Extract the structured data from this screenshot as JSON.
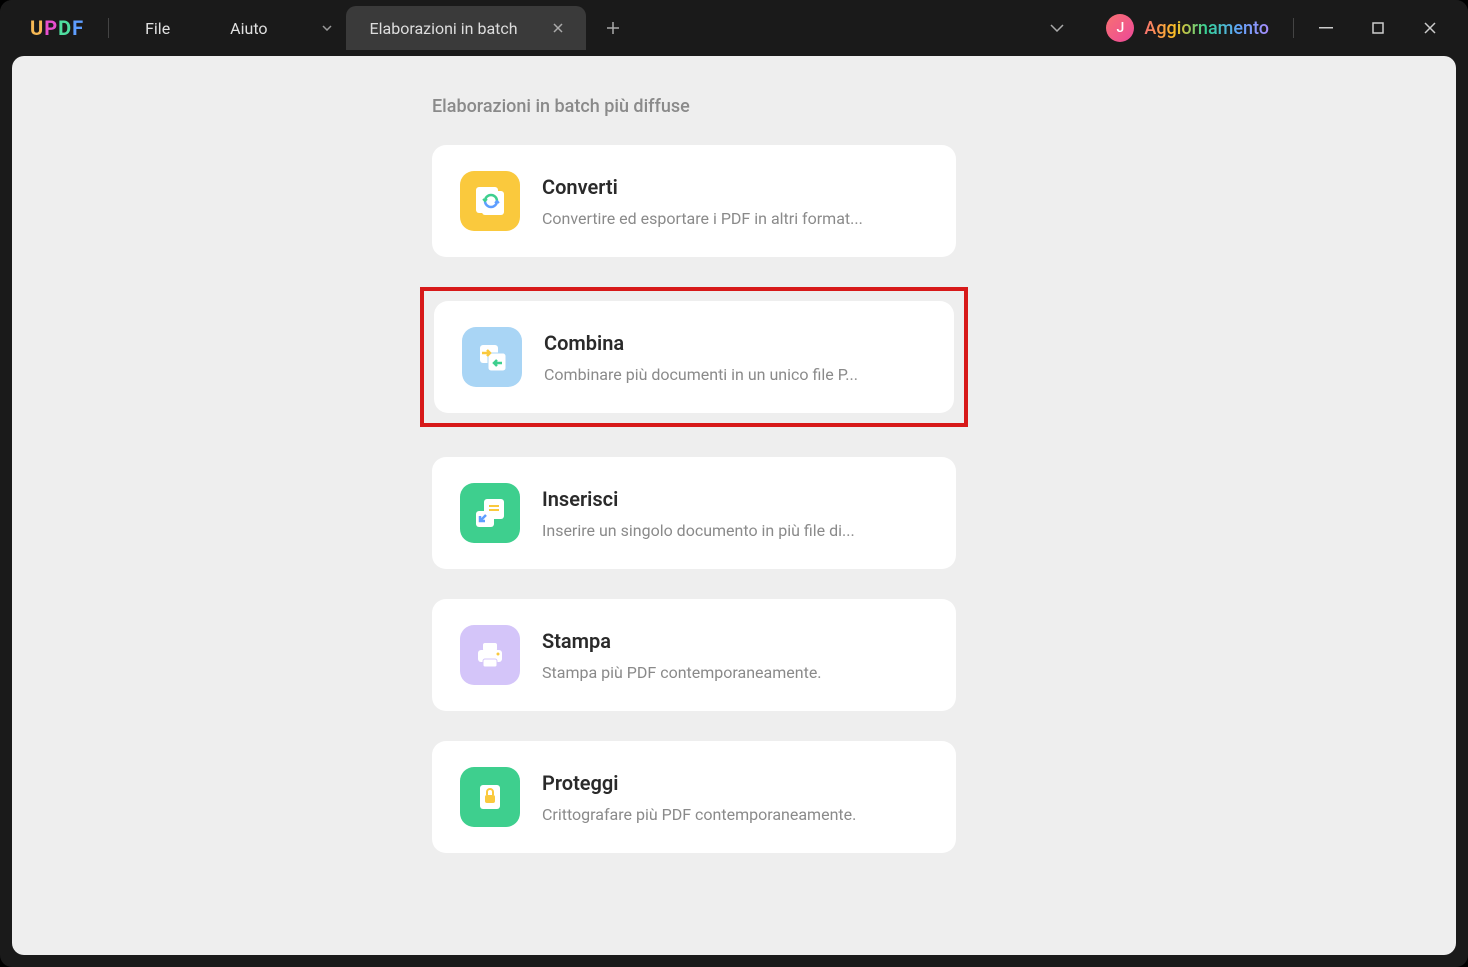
{
  "app": {
    "logo": "UPDF"
  },
  "menu": {
    "file": "File",
    "help": "Aiuto"
  },
  "tab": {
    "title": "Elaborazioni in batch"
  },
  "user": {
    "avatar_letter": "J",
    "update_label": "Aggiornamento"
  },
  "section": {
    "title": "Elaborazioni in batch più diffuse"
  },
  "cards": [
    {
      "title": "Converti",
      "desc": "Convertire ed esportare i PDF in altri format..."
    },
    {
      "title": "Combina",
      "desc": "Combinare più documenti in un unico file P..."
    },
    {
      "title": "Inserisci",
      "desc": "Inserire un singolo documento in più file di..."
    },
    {
      "title": "Stampa",
      "desc": "Stampa più PDF contemporaneamente."
    },
    {
      "title": "Proteggi",
      "desc": "Crittografare più PDF contemporaneamente."
    }
  ]
}
